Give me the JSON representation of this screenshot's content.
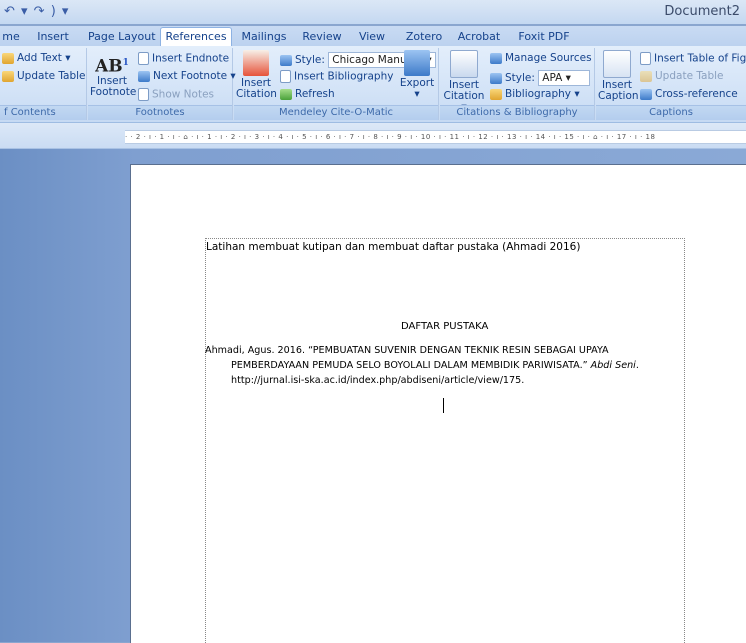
{
  "window": {
    "quick_access": "↶ ▾ ↷ ) ▾",
    "document_title": "Document2"
  },
  "tabs": [
    "me",
    "Insert",
    "Page Layout",
    "References",
    "Mailings",
    "Review",
    "View",
    "Zotero",
    "Acrobat",
    "Foxit PDF"
  ],
  "active_tab": "References",
  "ribbon": {
    "toc": {
      "add_text": "Add Text ▾",
      "update_table": "Update Table",
      "label": "f Contents"
    },
    "footnotes": {
      "insert_footnote_line1": "Insert",
      "insert_footnote_line2": "Footnote",
      "insert_endnote": "Insert Endnote",
      "next_footnote": "Next Footnote ▾",
      "show_notes": "Show Notes",
      "label": "Footnotes"
    },
    "mendeley": {
      "style_label": "Style:",
      "style_value": "Chicago Manua...",
      "insert_bibliography": "Insert Bibliography",
      "insert_citation_line1": "Insert",
      "insert_citation_line2": "Citation",
      "refresh": "Refresh",
      "export": "Export",
      "label": "Mendeley Cite-O-Matic"
    },
    "citations": {
      "insert_citation_line1": "Insert",
      "insert_citation_line2": "Citation ▾",
      "manage_sources": "Manage Sources",
      "style_label": "Style:",
      "style_value": "APA",
      "bibliography": "Bibliography ▾",
      "label": "Citations & Bibliography"
    },
    "captions": {
      "insert_caption_line1": "Insert",
      "insert_caption_line2": "Caption",
      "insert_table_of_figures": "Insert Table of Figur",
      "update_table": "Update Table",
      "cross_reference": "Cross-reference",
      "label": "Captions"
    }
  },
  "ruler_text": "· · 2 · ı · 1 · ı · ⌂ · ı · 1 · ı · 2 · ı · 3 · ı · 4 · ı · 5 · ı · 6 · ı · 7 · ı · 8 · ı · 9 · ı · 10 · ı · 11 · ı · 12 · ı · 13 · ı · 14 · ı · 15 · ı · ⌂ · ı · 17 · ı · 18",
  "document": {
    "heading": "Latihan membuat kutipan dan membuat daftar pustaka (Ahmadi 2016)",
    "section_title": "DAFTAR PUSTAKA",
    "ref_line1": "Ahmadi, Agus. 2016. “PEMBUATAN SUVENIR DENGAN TEKNIK RESIN SEBAGAI UPAYA",
    "ref_line2_plain": "PEMBERDAYAAN PEMUDA SELO BOYOLALI DALAM MEMBIDIK PARIWISATA.” ",
    "ref_line2_italic": "Abdi Seni",
    "ref_line2_end": ".",
    "ref_line3": "http://jurnal.isi-ska.ac.id/index.php/abdiseni/article/view/175."
  }
}
